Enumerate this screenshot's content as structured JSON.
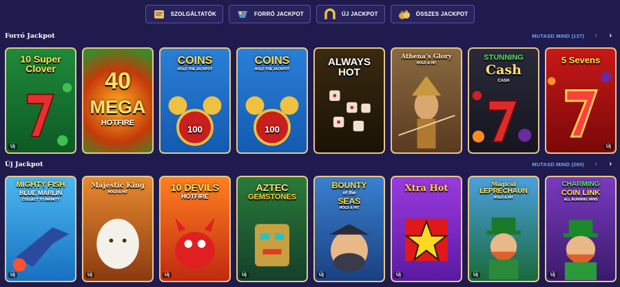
{
  "nav_tabs": [
    {
      "label": "SZOLGÁLTATÓK",
      "icon": "scroll-icon"
    },
    {
      "label": "FORRÓ JACKPOT",
      "icon": "gem-cup-icon"
    },
    {
      "label": "ÚJ JACKPOT",
      "icon": "horseshoe-icon"
    },
    {
      "label": "ÖSSZES JACKPOT",
      "icon": "money-bags-icon"
    }
  ],
  "hot_section": {
    "title": "Forró Jackpot",
    "show_all": "MUTASD MIND (137)",
    "games": [
      {
        "title_lines": [
          "10 Super",
          "Clover"
        ],
        "badge": "Új"
      },
      {
        "title_lines": [
          "40",
          "MEGA",
          "HOTFIRE"
        ],
        "badge": ""
      },
      {
        "title_lines": [
          "COINS"
        ],
        "sub": "HOLD THE JACKPOT",
        "coin_label": "100",
        "badge": ""
      },
      {
        "title_lines": [
          "COINS"
        ],
        "sub": "HOLD THE JACKPOT",
        "coin_label": "100",
        "badge": ""
      },
      {
        "title_lines": [
          "ALWAYS",
          "HOT"
        ],
        "badge": ""
      },
      {
        "title_lines": [
          "Athena's Glory"
        ],
        "sub": "HOLD & HIT",
        "badge": ""
      },
      {
        "title_lines": [
          "STUNNING",
          "Cash"
        ],
        "sub": "CASH",
        "badge": ""
      },
      {
        "title_lines": [
          "5 Sevens"
        ],
        "badge": "Új"
      }
    ]
  },
  "new_section": {
    "title": "Új Jackpot",
    "show_all": "MUTASD MIND (280)",
    "games": [
      {
        "title_lines": [
          "MIGHTY FISH",
          "BLUE MARLIN"
        ],
        "sub": "COLLECT TO INFINITY",
        "badge": "Új"
      },
      {
        "title_lines": [
          "Majestic King"
        ],
        "sub": "HOLD & HIT",
        "badge": "Új"
      },
      {
        "title_lines": [
          "10 DEVILS",
          "HOTFIRE"
        ],
        "badge": "Új"
      },
      {
        "title_lines": [
          "AZTEC",
          "GEMSTONES"
        ],
        "badge": "Új"
      },
      {
        "title_lines": [
          "BOUNTY",
          "of the",
          "SEAS"
        ],
        "sub": "HOLD & HIT",
        "badge": "Új"
      },
      {
        "title_lines": [
          "Xtra Hot"
        ],
        "badge": "Új"
      },
      {
        "title_lines": [
          "Magical",
          "LEPRECHAUN"
        ],
        "sub": "HOLD & HIT",
        "badge": "Új"
      },
      {
        "title_lines": [
          "CHARMING",
          "COIN LINK"
        ],
        "sub": "ALL RUNNING WINS",
        "badge": "Új"
      }
    ]
  }
}
